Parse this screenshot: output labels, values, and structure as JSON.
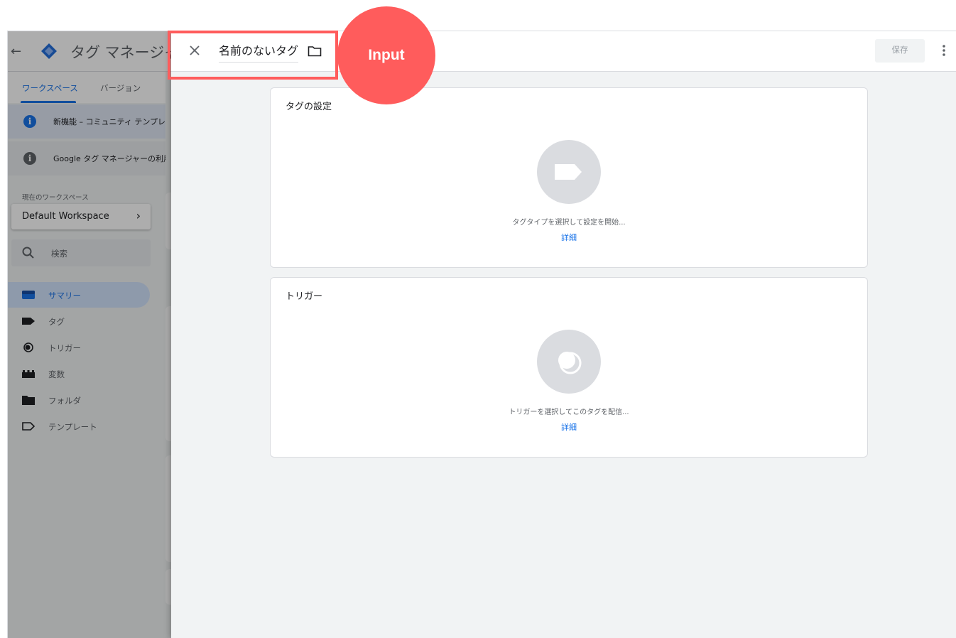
{
  "background_app": {
    "title": "タグ マネージャー",
    "tabs": [
      "ワークスペース",
      "バージョン"
    ],
    "notices": [
      {
        "text": "新機能 – コミュニティ テンプレー",
        "icon": "info-icon",
        "color": "#1a73e8"
      },
      {
        "text": "Google タグ マネージャーの利用規",
        "icon": "info-icon",
        "color": "#5f6368"
      }
    ],
    "workspace_label": "現在のワークスペース",
    "workspace_name": "Default Workspace",
    "search_placeholder": "検索",
    "nav": [
      {
        "label": "サマリー",
        "icon": "summary-icon",
        "active": true
      },
      {
        "label": "タグ",
        "icon": "tag-icon",
        "active": false
      },
      {
        "label": "トリガー",
        "icon": "trigger-icon",
        "active": false
      },
      {
        "label": "変数",
        "icon": "variables-icon",
        "active": false
      },
      {
        "label": "フォルダ",
        "icon": "folder-icon",
        "active": false
      },
      {
        "label": "テンプレート",
        "icon": "template-icon",
        "active": false
      }
    ]
  },
  "editor": {
    "tag_name": "名前のないタグ",
    "save_label": "保存",
    "tag_config": {
      "title": "タグの設定",
      "hint": "タグタイプを選択して設定を開始...",
      "link": "詳細"
    },
    "triggering": {
      "title": "トリガー",
      "hint": "トリガーを選択してこのタグを配信...",
      "link": "詳細"
    }
  },
  "annotation": {
    "badge_label": "Input",
    "color": "#ff5c5c"
  }
}
